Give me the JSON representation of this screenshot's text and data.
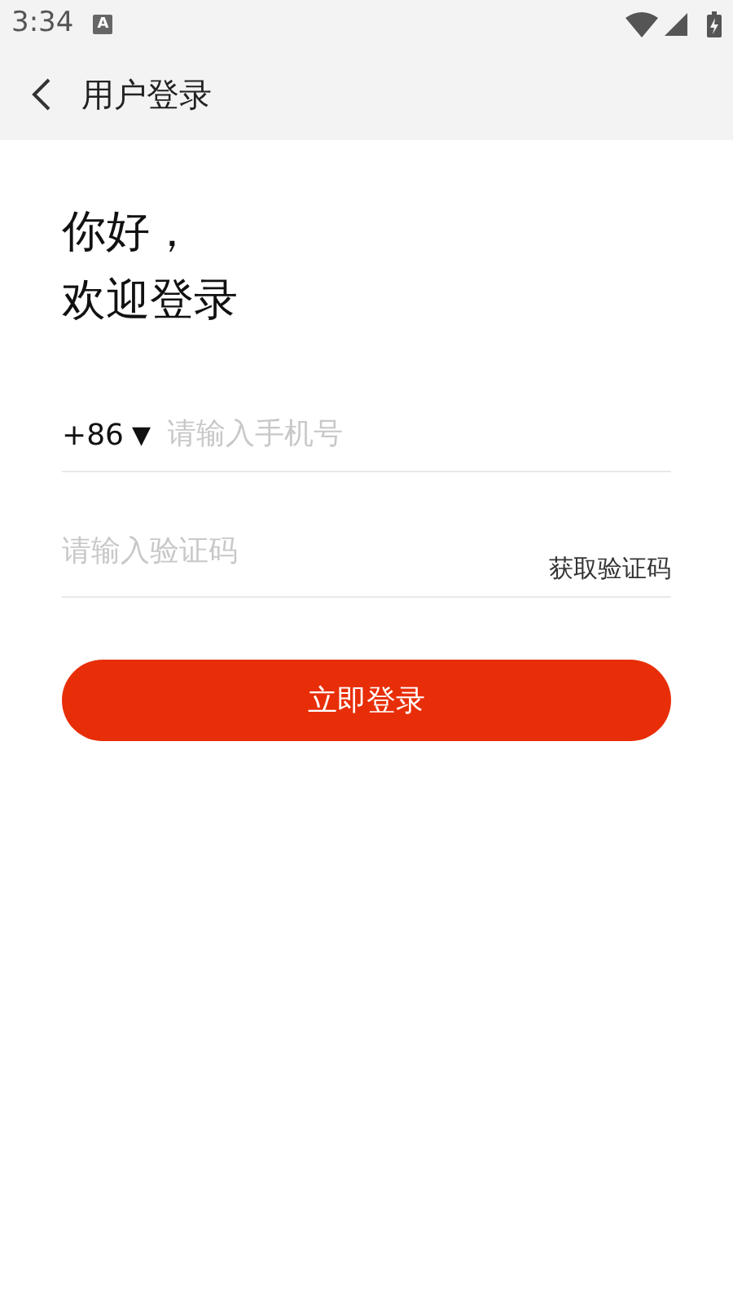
{
  "status_bar": {
    "time": "3:34",
    "notification": "A"
  },
  "toolbar": {
    "title": "用户登录"
  },
  "greeting": [
    "你好，",
    "欢迎登录"
  ],
  "phone": {
    "country_code": "+86",
    "dropdown": "▼",
    "placeholder": "请输入手机号"
  },
  "code": {
    "placeholder": "请输入验证码",
    "get_code": "获取验证码"
  },
  "login_button": "立即登录"
}
